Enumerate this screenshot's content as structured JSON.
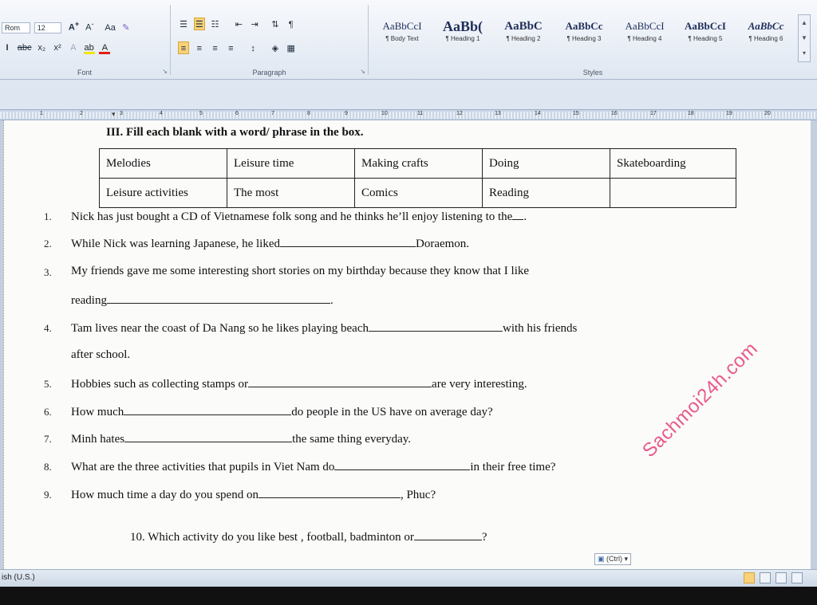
{
  "ribbon": {
    "font": {
      "font_name": "Rom",
      "font_size": "12",
      "group_label": "Font"
    },
    "paragraph": {
      "group_label": "Paragraph"
    },
    "styles": {
      "group_label": "Styles",
      "items": [
        {
          "sample": "AaBbCcI",
          "name": "¶ Body Text"
        },
        {
          "sample": "AaBb(",
          "name": "¶ Heading 1"
        },
        {
          "sample": "AaBbC",
          "name": "¶ Heading 2"
        },
        {
          "sample": "AaBbCc",
          "name": "¶ Heading 3"
        },
        {
          "sample": "AaBbCcI",
          "name": "¶ Heading 4"
        },
        {
          "sample": "AaBbCcI",
          "name": "¶ Heading 5"
        },
        {
          "sample": "AaBbCc",
          "name": "¶ Heading 6"
        }
      ]
    }
  },
  "ruler": {
    "numbers": [
      "1",
      "2",
      "3",
      "4",
      "5",
      "6",
      "7",
      "8",
      "9",
      "10",
      "11",
      "12",
      "13",
      "14",
      "15",
      "16",
      "17",
      "18",
      "19",
      "20"
    ]
  },
  "document": {
    "heading": "III. Fill each blank with a word/ phrase in the box.",
    "word_box": [
      [
        "Melodies",
        "Leisure time",
        "Making crafts",
        "Doing",
        "Skateboarding"
      ],
      [
        "Leisure activities",
        "The most",
        "Comics",
        "Reading",
        ""
      ]
    ],
    "questions": {
      "q1": {
        "num": "1.",
        "before": "Nick has just bought a CD of Vietnamese folk song and he thinks he’ll enjoy listening to the",
        "after": "."
      },
      "q2": {
        "num": "2.",
        "before": "While Nick was learning Japanese, he liked",
        "after": "Doraemon."
      },
      "q3": {
        "num": "3.",
        "line1": "My friends gave me some interesting short stories on my birthday because they know that I like",
        "before": "reading",
        "after": "."
      },
      "q4": {
        "num": "4.",
        "before": "Tam lives near the coast of Da Nang so he likes playing beach",
        "after": "with his friends",
        "line2": "after school."
      },
      "q5": {
        "num": "5.",
        "before": "Hobbies such as collecting stamps or",
        "after": "are very interesting."
      },
      "q6": {
        "num": "6.",
        "before": "How much",
        "after": "do people in the US have on average day?"
      },
      "q7": {
        "num": "7.",
        "before": "Minh hates",
        "after": "the same thing everyday."
      },
      "q8": {
        "num": "8.",
        "before": "What are the three activities that pupils in Viet Nam do",
        "after": "in their free time?"
      },
      "q9": {
        "num": "9.",
        "before": "How much time a day do you spend on",
        "after": ", Phuc?"
      },
      "q10": {
        "text": "10. Which activity do you like best , football, badminton or",
        "after": "?"
      }
    },
    "watermark": "Sachmoi24h.com",
    "paste_options": "(Ctrl) ▾"
  },
  "statusbar": {
    "language": "ish (U.S.)"
  }
}
